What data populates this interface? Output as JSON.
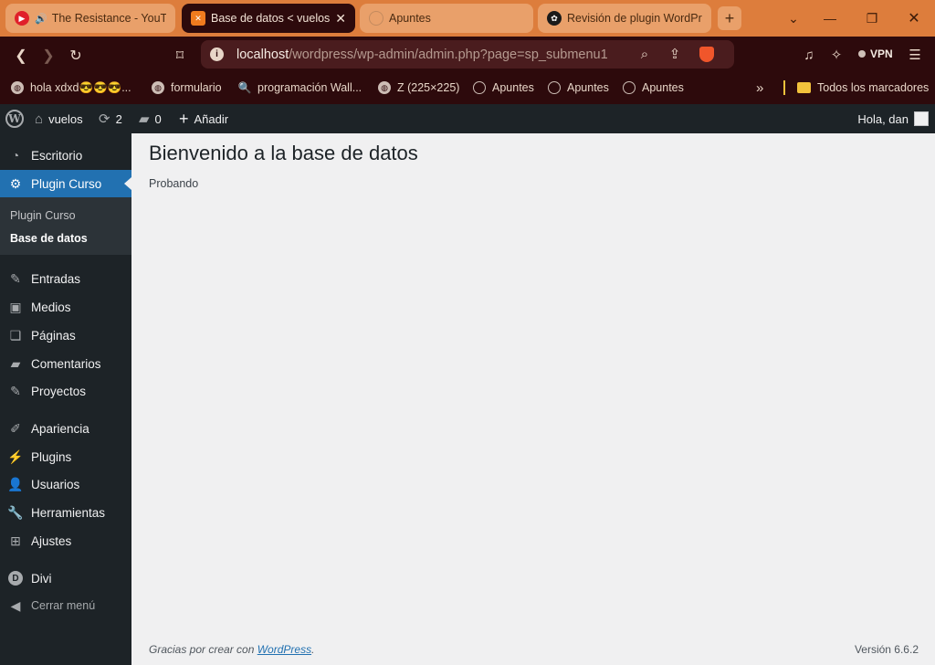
{
  "browser": {
    "tabs": [
      {
        "title": "The Resistance - YouTube",
        "active": false,
        "icon": "youtube-icon"
      },
      {
        "title": "Base de datos < vuelos",
        "active": true,
        "icon": "xampp-icon"
      },
      {
        "title": "Apuntes",
        "active": false,
        "icon": "loading-icon"
      },
      {
        "title": "Revisión de plugin WordPress",
        "active": false,
        "icon": "openai-icon"
      }
    ],
    "url_host": "localhost",
    "url_path": "/wordpress/wp-admin/admin.php?page=sp_submenu1",
    "vpn_label": "VPN",
    "bookmarks": [
      {
        "label": "hola xdxd😎😎😎...",
        "icon": "globe-icon"
      },
      {
        "label": "formulario",
        "icon": "globe-icon"
      },
      {
        "label": "programación Wall...",
        "icon": "search-icon"
      },
      {
        "label": "Z (225×225)",
        "icon": "globe-icon"
      },
      {
        "label": "Apuntes",
        "icon": "loading-icon"
      },
      {
        "label": "Apuntes",
        "icon": "loading-icon"
      },
      {
        "label": "Apuntes",
        "icon": "loading-icon"
      }
    ],
    "more_bookmarks": "»",
    "all_bookmarks_label": "Todos los marcadores"
  },
  "adminbar": {
    "site_name": "vuelos",
    "updates_count": "2",
    "comments_count": "0",
    "add_new_label": "Añadir",
    "greeting": "Hola, dan"
  },
  "sidebar": {
    "dashboard": "Escritorio",
    "plugin_curso": "Plugin Curso",
    "submenu": [
      "Plugin Curso",
      "Base de datos"
    ],
    "posts": "Entradas",
    "media": "Medios",
    "pages": "Páginas",
    "comments": "Comentarios",
    "projects": "Proyectos",
    "appearance": "Apariencia",
    "plugins": "Plugins",
    "users": "Usuarios",
    "tools": "Herramientas",
    "settings": "Ajustes",
    "divi": "Divi",
    "collapse": "Cerrar menú"
  },
  "main": {
    "title": "Bienvenido a la base de datos",
    "text": "Probando"
  },
  "footer": {
    "thanks_prefix": "Gracias por crear con ",
    "thanks_link": "WordPress",
    "thanks_suffix": ".",
    "version": "Versión 6.6.2"
  },
  "colors": {
    "wp_admin_bar": "#1d2327",
    "wp_highlight": "#2271b1",
    "browser_tabbar": "#dd7d3c",
    "browser_toolbar": "#2d0a0c"
  }
}
